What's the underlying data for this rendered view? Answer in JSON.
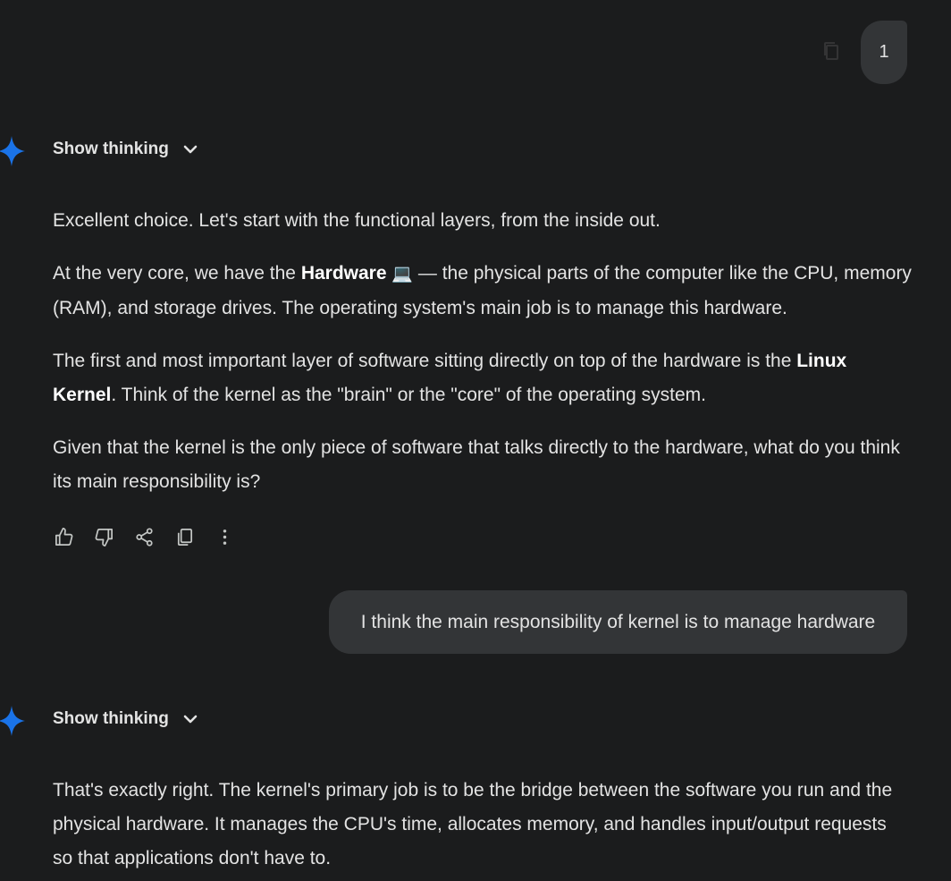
{
  "user_messages": [
    {
      "text": "1"
    },
    {
      "text": "I think the main responsibility of kernel is to manage hardware"
    }
  ],
  "responses": [
    {
      "thinking_label": "Show thinking",
      "paragraphs": {
        "p1": "Excellent choice. Let's start with the functional layers, from the inside out.",
        "p2_pre": "At the very core, we have the ",
        "p2_bold": "Hardware",
        "p2_emoji": "💻",
        "p2_post": " — the physical parts of the computer like the CPU, memory (RAM), and storage drives. The operating system's main job is to manage this hardware.",
        "p3_pre": "The first and most important layer of software sitting directly on top of the hardware is the ",
        "p3_bold": "Linux Kernel",
        "p3_post": ". Think of the kernel as the \"brain\" or the \"core\" of the operating system.",
        "p4": "Given that the kernel is the only piece of software that talks directly to the hardware, what do you think its main responsibility is?"
      }
    },
    {
      "thinking_label": "Show thinking",
      "paragraphs": {
        "p1": "That's exactly right. The kernel's primary job is to be the bridge between the software you run and the physical hardware. It manages the CPU's time, allocates memory, and handles input/output requests so that applications don't have to."
      }
    }
  ],
  "actions": [
    "thumbs-up-icon",
    "thumbs-down-icon",
    "share-icon",
    "copy-icon",
    "more-vert-icon"
  ],
  "colors": {
    "background": "#1b1c1d",
    "bubble": "#333537",
    "text": "#e3e3e3",
    "spark": "#1a73e8"
  }
}
